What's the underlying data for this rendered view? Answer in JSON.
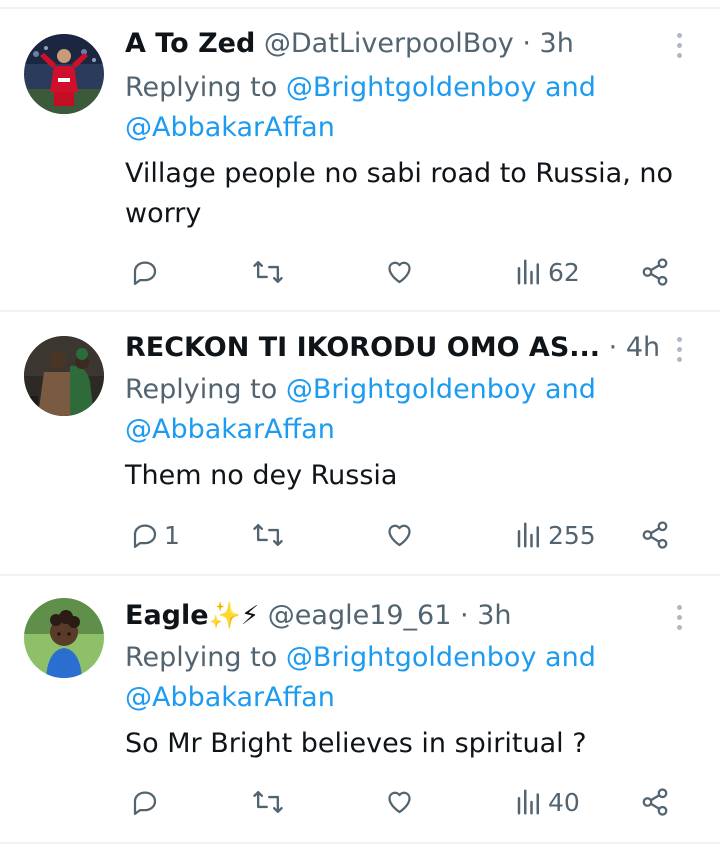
{
  "tweets": [
    {
      "name": "A To Zed",
      "handle": "@DatLiverpoolBoy",
      "sep": "·",
      "time": "3h",
      "replying_prefix": "Replying to",
      "replying_user1": "@Brightgoldenboy",
      "replying_and": "and",
      "replying_user2": "@AbbakarAffan",
      "text_line1": "Village people no sabi road to Russia, no",
      "text_line2": "worry",
      "reply_count": "",
      "view_count": "62"
    },
    {
      "name": "RECKON TI IKORODU OMO AS...",
      "handle": "",
      "sep": "·",
      "time": "4h",
      "replying_prefix": "Replying to",
      "replying_user1": "@Brightgoldenboy",
      "replying_and": "and",
      "replying_user2": "@AbbakarAffan",
      "text_line1": "Them no dey Russia",
      "text_line2": "",
      "reply_count": "1",
      "view_count": "255"
    },
    {
      "name": "Eagle",
      "name_emoji": "✨⚡",
      "handle": "@eagle19_61",
      "sep": "·",
      "time": "3h",
      "replying_prefix": "Replying to",
      "replying_user1": "@Brightgoldenboy",
      "replying_and": "and",
      "replying_user2": "@AbbakarAffan",
      "text_line1": "So Mr Bright believes in spiritual ?",
      "text_line2": "",
      "reply_count": "",
      "view_count": "40"
    }
  ],
  "colors": {
    "text": "#0f1419",
    "secondary": "#536471",
    "link": "#1d9bf0",
    "divider": "#eff3f4"
  },
  "icons": [
    "reply-icon",
    "retweet-icon",
    "like-icon",
    "views-icon",
    "share-icon",
    "more-icon"
  ]
}
